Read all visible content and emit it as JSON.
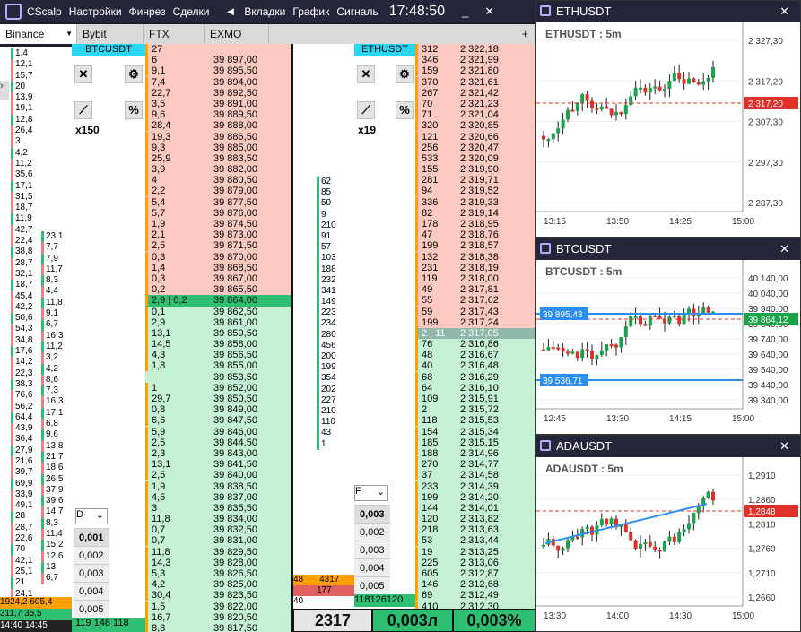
{
  "titlebar": {
    "app": "CScalp",
    "menu": [
      "Настройки",
      "Финрез",
      "Сделки"
    ],
    "menu2": [
      "Вкладки",
      "График",
      "Сигналь"
    ],
    "clock": "17:48:50",
    "minimize": "_",
    "close": "✕"
  },
  "exchange_tabs": [
    "Binance",
    "Bybit",
    "FTX",
    "EXMO"
  ],
  "add_tab": "+",
  "left_stats": [
    "1,4",
    "12,1",
    "15,7",
    "20",
    "13,9",
    "19,1",
    "12,8",
    "26,4",
    "3",
    "4,2",
    "11,2",
    "35,6",
    "17,1",
    "31,5",
    "18,7",
    "11,9",
    "42,7",
    "22,4",
    "38,8",
    "28,7",
    "32,1",
    "18,7",
    "45,4",
    "42,2",
    "50,6",
    "54,3",
    "34,8",
    "17,6",
    "14,2",
    "22,3",
    "38,3",
    "76,6",
    "56,2",
    "64,4",
    "43,9",
    "36,4",
    "27,9",
    "21,6",
    "39,7",
    "69,9",
    "33,9",
    "49,1",
    "28",
    "28,7",
    "22,6",
    "70",
    "42,1",
    "25,1",
    "21",
    "24,1",
    "13,1"
  ],
  "left_stats2": [
    "23,1",
    "7,7",
    "7,9",
    "11,7",
    "8,3",
    "4,4",
    "11,8",
    "9,1",
    "6,7",
    "16,3",
    "11,2",
    "3,2",
    "4,2",
    "8,6",
    "7,3",
    "16,3",
    "17,1",
    "6,8",
    "9,6",
    "13,8",
    "21,7",
    "18,6",
    "26,5",
    "37,9",
    "39,6",
    "14,7",
    "8,3",
    "11,4",
    "15,2",
    "12,6",
    "13",
    "6,7"
  ],
  "left_bottom": {
    "a": "1924,2",
    "b": "605,4",
    "c": "311,7",
    "d": "35,5",
    "t1": "14:40",
    "t2": "14:45"
  },
  "btc_panel": {
    "ticker": "BTCUSDT",
    "leverage": "x150",
    "dropdown": "D",
    "sizes": [
      "0,001",
      "0,002",
      "0,003",
      "0,004",
      "0,005"
    ],
    "bottom": [
      "119",
      "148",
      "118"
    ]
  },
  "eth_panel": {
    "ticker": "ETHUSDT",
    "leverage": "x19",
    "dropdown": "F",
    "sizes": [
      "0,003",
      "0,002",
      "0,003",
      "0,004",
      "0,005"
    ],
    "bottom": [
      "118",
      "126",
      "120"
    ],
    "last_price": "2317",
    "size": "0,003л",
    "pct": "0,003%"
  },
  "btc_book": {
    "asks": [
      [
        "27",
        ""
      ],
      [
        "6",
        "39 897,00"
      ],
      [
        "9,1",
        "39 895,50"
      ],
      [
        "7,4",
        "39 894,00"
      ],
      [
        "22,7",
        "39 892,50"
      ],
      [
        "3,5",
        "39 891,00"
      ],
      [
        "9,6",
        "39 889,50"
      ],
      [
        "28,4",
        "39 888,00"
      ],
      [
        "19,3",
        "39 886,50"
      ],
      [
        "9,3",
        "39 885,00"
      ],
      [
        "25,9",
        "39 883,50"
      ],
      [
        "3,9",
        "39 882,00"
      ],
      [
        "4",
        "39 880,50"
      ],
      [
        "2,2",
        "39 879,00"
      ],
      [
        "5,4",
        "39 877,50"
      ],
      [
        "5,7",
        "39 876,00"
      ],
      [
        "1,9",
        "39 874,50"
      ],
      [
        "2,1",
        "39 873,00"
      ],
      [
        "2,5",
        "39 871,50"
      ],
      [
        "0,3",
        "39 870,00"
      ],
      [
        "1,4",
        "39 868,50"
      ],
      [
        "0,3",
        "39 867,00"
      ],
      [
        "0,2",
        "39 865,50"
      ]
    ],
    "spread": [
      "2,9 | 0,2",
      "39 864,00"
    ],
    "bids": [
      [
        "0,1",
        "39 862,50"
      ],
      [
        "2,9",
        "39 861,00"
      ],
      [
        "13,1",
        "39 859,50"
      ],
      [
        "14,5",
        "39 858,00"
      ],
      [
        "4,3",
        "39 856,50"
      ],
      [
        "1,8",
        "39 855,00"
      ],
      [
        "",
        "39 853,50"
      ],
      [
        "1",
        "39 852,00"
      ],
      [
        "29,7",
        "39 850,50"
      ],
      [
        "0,8",
        "39 849,00"
      ],
      [
        "6,6",
        "39 847,50"
      ],
      [
        "5,9",
        "39 846,00"
      ],
      [
        "2,5",
        "39 844,50"
      ],
      [
        "2,3",
        "39 843,00"
      ],
      [
        "13,1",
        "39 841,50"
      ],
      [
        "2,5",
        "39 840,00"
      ],
      [
        "1,9",
        "39 838,50"
      ],
      [
        "4,5",
        "39 837,00"
      ],
      [
        "3",
        "39 835,50"
      ],
      [
        "11,8",
        "39 834,00"
      ],
      [
        "0,7",
        "39 832,50"
      ],
      [
        "0,7",
        "39 831,00"
      ],
      [
        "11,8",
        "39 829,50"
      ],
      [
        "14,3",
        "39 828,00"
      ],
      [
        "5,3",
        "39 826,50"
      ],
      [
        "4,2",
        "39 825,00"
      ],
      [
        "30,4",
        "39 823,50"
      ],
      [
        "1,5",
        "39 822,00"
      ],
      [
        "16,7",
        "39 820,50"
      ],
      [
        "8,8",
        "39 817,50"
      ]
    ]
  },
  "eth_book": {
    "asks": [
      [
        "312",
        "2 322,18"
      ],
      [
        "346",
        "2 321,99"
      ],
      [
        "159",
        "2 321,80"
      ],
      [
        "370",
        "2 321,61"
      ],
      [
        "267",
        "2 321,42"
      ],
      [
        "70",
        "2 321,23"
      ],
      [
        "71",
        "2 321,04"
      ],
      [
        "320",
        "2 320,85"
      ],
      [
        "121",
        "2 320,66"
      ],
      [
        "256",
        "2 320,47"
      ],
      [
        "533",
        "2 320,09"
      ],
      [
        "155",
        "2 319,90"
      ],
      [
        "281",
        "2 319,71"
      ],
      [
        "94",
        "2 319,52"
      ],
      [
        "336",
        "2 319,33"
      ],
      [
        "82",
        "2 319,14"
      ],
      [
        "178",
        "2 318,95"
      ],
      [
        "47",
        "2 318,76"
      ],
      [
        "199",
        "2 318,57"
      ],
      [
        "132",
        "2 318,38"
      ],
      [
        "231",
        "2 318,19"
      ],
      [
        "119",
        "2 318,00"
      ],
      [
        "49",
        "2 317,81"
      ],
      [
        "55",
        "2 317,62"
      ],
      [
        "59",
        "2 317,43"
      ],
      [
        "199",
        "2 317,24"
      ]
    ],
    "spread": [
      "2 | 11",
      "2 317,05"
    ],
    "bids": [
      [
        "76",
        "2 316,86"
      ],
      [
        "48",
        "2 316,67"
      ],
      [
        "40",
        "2 316,48"
      ],
      [
        "68",
        "2 316,29"
      ],
      [
        "64",
        "2 316,10"
      ],
      [
        "109",
        "2 315,91"
      ],
      [
        "2",
        "2 315,72"
      ],
      [
        "118",
        "2 315,53"
      ],
      [
        "154",
        "2 315,34"
      ],
      [
        "185",
        "2 315,15"
      ],
      [
        "188",
        "2 314,96"
      ],
      [
        "270",
        "2 314,77"
      ],
      [
        "37",
        "2 314,58"
      ],
      [
        "233",
        "2 314,39"
      ],
      [
        "199",
        "2 314,20"
      ],
      [
        "144",
        "2 314,01"
      ],
      [
        "120",
        "2 313,82"
      ],
      [
        "218",
        "2 313,63"
      ],
      [
        "53",
        "2 313,44"
      ],
      [
        "19",
        "2 313,25"
      ],
      [
        "225",
        "2 313,06"
      ],
      [
        "605",
        "2 312,87"
      ],
      [
        "146",
        "2 312,68"
      ],
      [
        "69",
        "2 312,49"
      ],
      [
        "410",
        "2 312,30"
      ]
    ]
  },
  "cluster_col": [
    "62",
    "85",
    "50",
    "9",
    "210",
    "91",
    "57",
    "103",
    "188",
    "232",
    "341",
    "149",
    "223",
    "234",
    "280",
    "456",
    "200",
    "199",
    "354",
    "202",
    "227",
    "210",
    "110",
    "43",
    "1"
  ],
  "cluster_bottom": {
    "a": "4317",
    "b": "177",
    "c": "48",
    "d": "40"
  },
  "charts": [
    {
      "title": "ETHUSDT",
      "label": "ETHUSDT : 5m",
      "yticks": [
        "2 327,30",
        "2 317,20",
        "2 307,30",
        "2 297,30",
        "2 287,30"
      ],
      "current": "2 317,20",
      "xticks": [
        "13:15",
        "13:50",
        "14:25",
        "15:00"
      ]
    },
    {
      "title": "BTCUSDT",
      "label": "BTCUSDT : 5m",
      "yticks": [
        "40 140,00",
        "40 040,00",
        "39 940,00",
        "39 840,00",
        "39 740,00",
        "39 640,00",
        "39 540,00",
        "39 440,00",
        "39 340,00"
      ],
      "current": "39 864,12",
      "level1": "39 895,43",
      "level2": "39 536,71",
      "xticks": [
        "12:45",
        "13:30",
        "14:15",
        "15:00"
      ]
    },
    {
      "title": "ADAUSDT",
      "label": "ADAUSDT : 5m",
      "yticks": [
        "1,2910",
        "1,2860",
        "1,2810",
        "1,2760",
        "1,2710",
        "1,2660"
      ],
      "current": "1,2848",
      "xticks": [
        "13:30",
        "14:00",
        "14:30",
        "15:00"
      ]
    }
  ],
  "colors": {
    "ask": "#fbc9c0",
    "bid": "#c4f0d4",
    "volume": "#ffa000",
    "accent_blue": "#2ad7f2",
    "bull": "#1aa34a",
    "bear": "#e0302a"
  }
}
